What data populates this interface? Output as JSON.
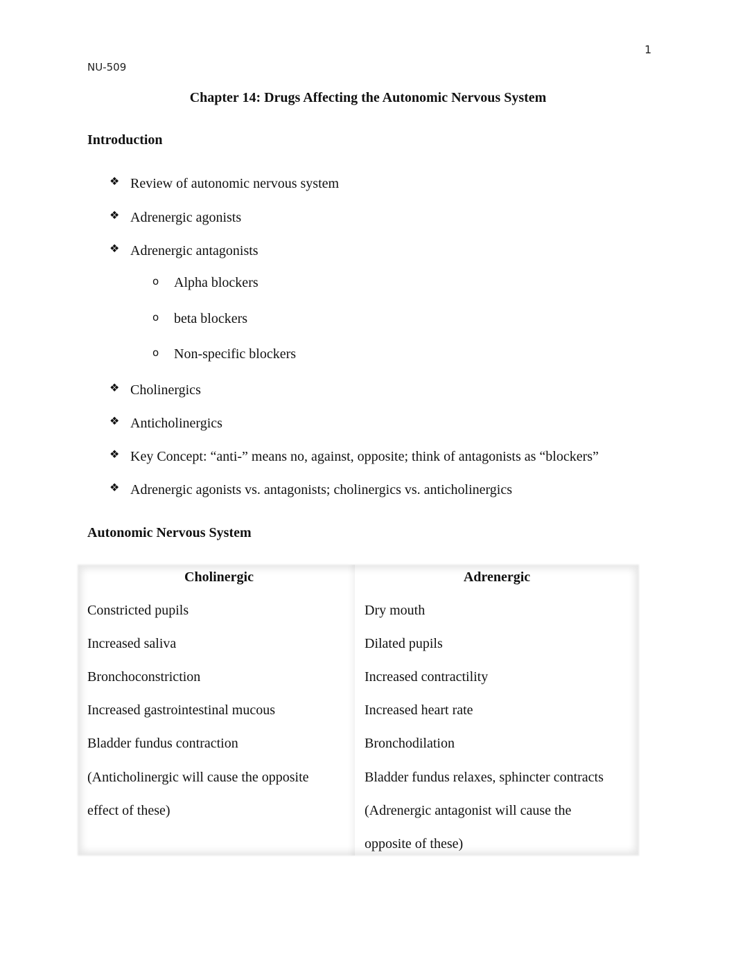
{
  "header": {
    "page_number": "1",
    "running_head": "NU-509"
  },
  "title": "Chapter 14: Drugs Affecting the Autonomic Nervous System",
  "introduction": {
    "heading": "Introduction",
    "bullet_icon": "diamond-cluster-icon",
    "sub_bullet_icon": "hollow-circle-icon",
    "items": [
      {
        "label": "Review of autonomic nervous system"
      },
      {
        "label": "Adrenergic agonists"
      },
      {
        "label": "Adrenergic antagonists",
        "sub_items": [
          "Alpha blockers",
          "beta blockers",
          "Non-specific blockers"
        ]
      },
      {
        "label": "Cholinergics"
      },
      {
        "label": "Anticholinergics"
      },
      {
        "label": "Key Concept: “anti-” means no, against, opposite; think of antagonists as “blockers”"
      },
      {
        "label": "Adrenergic agonists vs. antagonists; cholinergics vs. anticholinergics"
      }
    ]
  },
  "autonomic_nervous_system": {
    "heading": "Autonomic Nervous System",
    "table": {
      "columns": [
        {
          "header": "Cholinergic",
          "lines": [
            "Constricted pupils",
            "Increased saliva",
            "Bronchoconstriction",
            "Increased gastrointestinal mucous",
            "Bladder fundus contraction",
            "(Anticholinergic will cause the opposite",
            "effect of these)"
          ]
        },
        {
          "header": "Adrenergic",
          "lines": [
            "Dry mouth",
            "Dilated pupils",
            "Increased contractility",
            "Increased heart rate",
            "Bronchodilation",
            "Bladder fundus relaxes, sphincter contracts",
            "(Adrenergic antagonist will cause the",
            "opposite of these)"
          ]
        }
      ]
    }
  }
}
